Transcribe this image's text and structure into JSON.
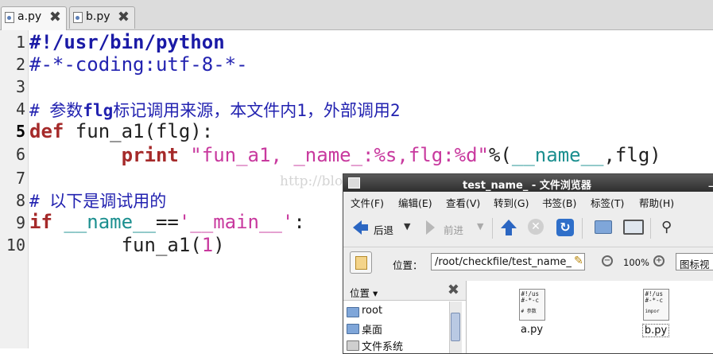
{
  "tabs": [
    {
      "label": "a.py",
      "active": true,
      "close": "✖"
    },
    {
      "label": "b.py",
      "active": false,
      "close": "✖"
    }
  ],
  "editor": {
    "line_numbers": [
      "1",
      "2",
      "3",
      "4",
      "5",
      "6",
      "7",
      "8",
      "9",
      "10"
    ],
    "current_line": "5",
    "code": {
      "l1": "#!/usr/bin/python",
      "l2": "#-*-coding:utf-8-*-",
      "l4_a": "# 参数",
      "l4_b": "flg",
      "l4_c": "标记调用来源，本文件内1，外部调用2",
      "l5_kw": "def",
      "l5_rest": " fun_a1(flg):",
      "l6_indent": "        ",
      "l6_kw": "print",
      "l6_sp": " ",
      "l6_str": "\"fun_a1, _name_:%s,flg:%d\"",
      "l6_pct": "%(",
      "l6_dn": "__name__",
      "l6_end": ",flg)",
      "l8": "# 以下是调试用的",
      "l9_kw": "if",
      "l9_sp": " ",
      "l9_dn": "__name__",
      "l9_eq": "==",
      "l9_str": "'__main__'",
      "l9_end": ":",
      "l10_a": "        fun_a1(",
      "l10_num": "1",
      "l10_b": ")"
    }
  },
  "watermark": "http://blog.csdn.net/",
  "file_browser": {
    "title": "test_name_ - 文件浏览器",
    "menu": [
      "文件(F)",
      "编辑(E)",
      "查看(V)",
      "转到(G)",
      "书签(B)",
      "标签(T)",
      "帮助(H)"
    ],
    "toolbar": {
      "back": "后退",
      "forward": "前进"
    },
    "location_label": "位置：",
    "location_value": "/root/checkfile/test_name_",
    "zoom": "100%",
    "view_mode": "图标视",
    "side_header": "位置",
    "places": [
      "root",
      "桌面",
      "文件系统"
    ],
    "files": [
      {
        "name": "a.py",
        "preview": [
          "#!/us",
          "#-*-c",
          "# 参数"
        ],
        "selected": false
      },
      {
        "name": "b.py",
        "preview": [
          "#!/us",
          "#-*-c",
          "impor"
        ],
        "selected": true
      }
    ]
  }
}
